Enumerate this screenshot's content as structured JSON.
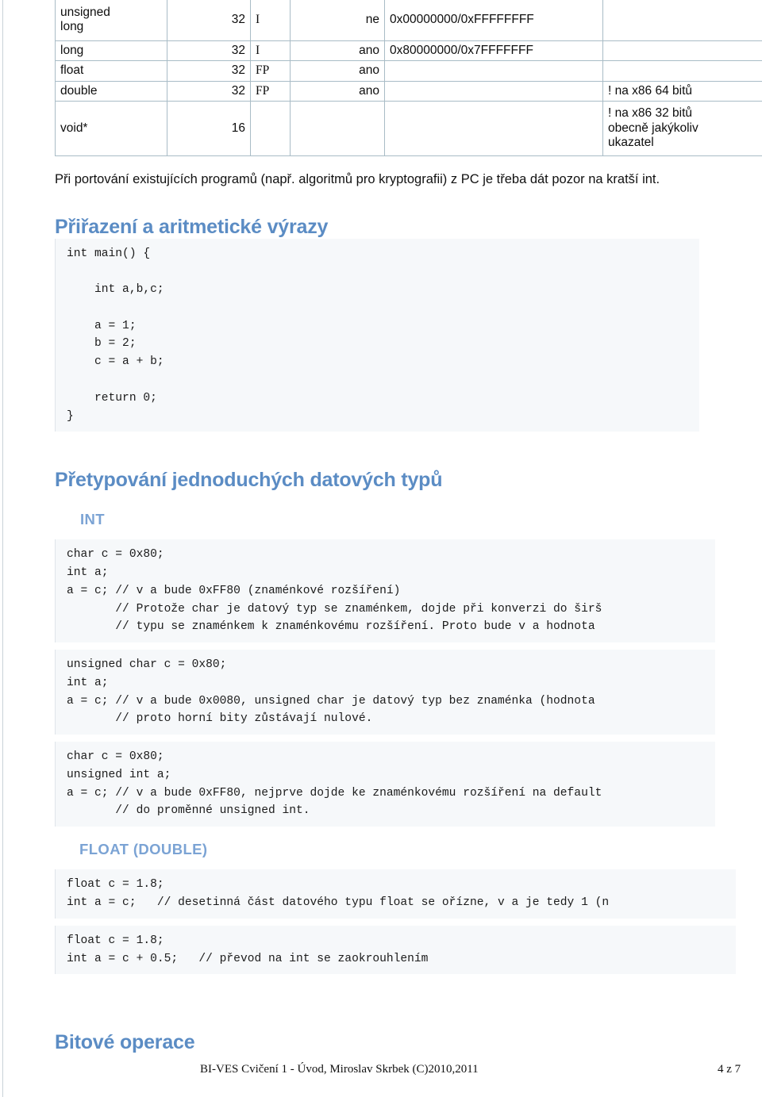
{
  "document": {
    "table": {
      "rows": [
        {
          "name": "unsigned long",
          "name_line1": "unsigned",
          "name_line2": "long",
          "size": "32",
          "kind": "I",
          "signed": "ne",
          "range": "0x00000000/0xFFFFFFFF",
          "note": ""
        },
        {
          "name": "long",
          "size": "32",
          "kind": "I",
          "signed": "ano",
          "range": "0x80000000/0x7FFFFFFF",
          "note": ""
        },
        {
          "name": "float",
          "size": "32",
          "kind": "FP",
          "signed": "ano",
          "range": "",
          "note": ""
        },
        {
          "name": "double",
          "size": "32",
          "kind": "FP",
          "signed": "ano",
          "range": "",
          "note": "! na x86 64 bitů"
        },
        {
          "name": "void*",
          "size": "16",
          "kind": "",
          "signed": "",
          "range": "",
          "note_line1": "! na x86 32 bitů",
          "note_line2": "obecně jakýkoliv",
          "note_line3": "ukazatel"
        }
      ]
    },
    "paragraph": "Při portování existujících programů (např. algoritmů pro kryptografii) z PC je třeba dát pozor na kratší int.",
    "heading_assignment": "Přiřazení a aritmetické výrazy",
    "code_main": "int main() {\n\n    int a,b,c;\n\n    a = 1;\n    b = 2;\n    c = a + b;\n\n    return 0;\n}",
    "heading_casting": "Přetypování jednoduchých datových typů",
    "subheading_int": "INT",
    "code_int_1": "char c = 0x80;\nint a;\na = c; // v a bude 0xFF80 (znaménkové rozšíření)\n       // Protože char je datový typ se znaménkem, dojde při konverzi do širš\n       // typu se znaménkem k znaménkovému rozšíření. Proto bude v a hodnota ",
    "code_int_2": "unsigned char c = 0x80;\nint a;\na = c; // v a bude 0x0080, unsigned char je datový typ bez znaménka (hodnota \n       // proto horní bity zůstávají nulové.",
    "code_int_3": "char c = 0x80;\nunsigned int a;\na = c; // v a bude 0xFF80, nejprve dojde ke znaménkovému rozšíření na default\n       // do proměnné unsigned int.",
    "subheading_float": "FLOAT (DOUBLE)",
    "code_float_1": "float c = 1.8;\nint a = c;   // desetinná část datového typu float se ořízne, v a je tedy 1 (n",
    "code_float_2": "float c = 1.8;\nint a = c + 0.5;   // převod na int se zaokrouhlením",
    "heading_bitwise": "Bitové operace",
    "footer": {
      "center": "BI-VES Cvičení 1 - Úvod, Miroslav Skrbek (C)2010,2011",
      "page": "4 z 7"
    },
    "colors": {
      "heading": "#5b8cc4",
      "subheading": "#7ba3d4",
      "code_bg": "#f6f8fa",
      "table_border": "#a9bcc6"
    }
  }
}
